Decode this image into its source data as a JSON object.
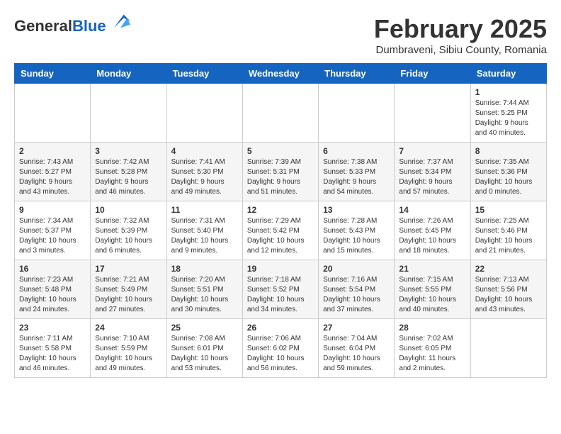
{
  "header": {
    "logo_general": "General",
    "logo_blue": "Blue",
    "month_title": "February 2025",
    "subtitle": "Dumbraveni, Sibiu County, Romania"
  },
  "calendar": {
    "days_of_week": [
      "Sunday",
      "Monday",
      "Tuesday",
      "Wednesday",
      "Thursday",
      "Friday",
      "Saturday"
    ],
    "weeks": [
      [
        {
          "day": "",
          "info": ""
        },
        {
          "day": "",
          "info": ""
        },
        {
          "day": "",
          "info": ""
        },
        {
          "day": "",
          "info": ""
        },
        {
          "day": "",
          "info": ""
        },
        {
          "day": "",
          "info": ""
        },
        {
          "day": "1",
          "info": "Sunrise: 7:44 AM\nSunset: 5:25 PM\nDaylight: 9 hours and 40 minutes."
        }
      ],
      [
        {
          "day": "2",
          "info": "Sunrise: 7:43 AM\nSunset: 5:27 PM\nDaylight: 9 hours and 43 minutes."
        },
        {
          "day": "3",
          "info": "Sunrise: 7:42 AM\nSunset: 5:28 PM\nDaylight: 9 hours and 46 minutes."
        },
        {
          "day": "4",
          "info": "Sunrise: 7:41 AM\nSunset: 5:30 PM\nDaylight: 9 hours and 49 minutes."
        },
        {
          "day": "5",
          "info": "Sunrise: 7:39 AM\nSunset: 5:31 PM\nDaylight: 9 hours and 51 minutes."
        },
        {
          "day": "6",
          "info": "Sunrise: 7:38 AM\nSunset: 5:33 PM\nDaylight: 9 hours and 54 minutes."
        },
        {
          "day": "7",
          "info": "Sunrise: 7:37 AM\nSunset: 5:34 PM\nDaylight: 9 hours and 57 minutes."
        },
        {
          "day": "8",
          "info": "Sunrise: 7:35 AM\nSunset: 5:36 PM\nDaylight: 10 hours and 0 minutes."
        }
      ],
      [
        {
          "day": "9",
          "info": "Sunrise: 7:34 AM\nSunset: 5:37 PM\nDaylight: 10 hours and 3 minutes."
        },
        {
          "day": "10",
          "info": "Sunrise: 7:32 AM\nSunset: 5:39 PM\nDaylight: 10 hours and 6 minutes."
        },
        {
          "day": "11",
          "info": "Sunrise: 7:31 AM\nSunset: 5:40 PM\nDaylight: 10 hours and 9 minutes."
        },
        {
          "day": "12",
          "info": "Sunrise: 7:29 AM\nSunset: 5:42 PM\nDaylight: 10 hours and 12 minutes."
        },
        {
          "day": "13",
          "info": "Sunrise: 7:28 AM\nSunset: 5:43 PM\nDaylight: 10 hours and 15 minutes."
        },
        {
          "day": "14",
          "info": "Sunrise: 7:26 AM\nSunset: 5:45 PM\nDaylight: 10 hours and 18 minutes."
        },
        {
          "day": "15",
          "info": "Sunrise: 7:25 AM\nSunset: 5:46 PM\nDaylight: 10 hours and 21 minutes."
        }
      ],
      [
        {
          "day": "16",
          "info": "Sunrise: 7:23 AM\nSunset: 5:48 PM\nDaylight: 10 hours and 24 minutes."
        },
        {
          "day": "17",
          "info": "Sunrise: 7:21 AM\nSunset: 5:49 PM\nDaylight: 10 hours and 27 minutes."
        },
        {
          "day": "18",
          "info": "Sunrise: 7:20 AM\nSunset: 5:51 PM\nDaylight: 10 hours and 30 minutes."
        },
        {
          "day": "19",
          "info": "Sunrise: 7:18 AM\nSunset: 5:52 PM\nDaylight: 10 hours and 34 minutes."
        },
        {
          "day": "20",
          "info": "Sunrise: 7:16 AM\nSunset: 5:54 PM\nDaylight: 10 hours and 37 minutes."
        },
        {
          "day": "21",
          "info": "Sunrise: 7:15 AM\nSunset: 5:55 PM\nDaylight: 10 hours and 40 minutes."
        },
        {
          "day": "22",
          "info": "Sunrise: 7:13 AM\nSunset: 5:56 PM\nDaylight: 10 hours and 43 minutes."
        }
      ],
      [
        {
          "day": "23",
          "info": "Sunrise: 7:11 AM\nSunset: 5:58 PM\nDaylight: 10 hours and 46 minutes."
        },
        {
          "day": "24",
          "info": "Sunrise: 7:10 AM\nSunset: 5:59 PM\nDaylight: 10 hours and 49 minutes."
        },
        {
          "day": "25",
          "info": "Sunrise: 7:08 AM\nSunset: 6:01 PM\nDaylight: 10 hours and 53 minutes."
        },
        {
          "day": "26",
          "info": "Sunrise: 7:06 AM\nSunset: 6:02 PM\nDaylight: 10 hours and 56 minutes."
        },
        {
          "day": "27",
          "info": "Sunrise: 7:04 AM\nSunset: 6:04 PM\nDaylight: 10 hours and 59 minutes."
        },
        {
          "day": "28",
          "info": "Sunrise: 7:02 AM\nSunset: 6:05 PM\nDaylight: 11 hours and 2 minutes."
        },
        {
          "day": "",
          "info": ""
        }
      ]
    ]
  }
}
